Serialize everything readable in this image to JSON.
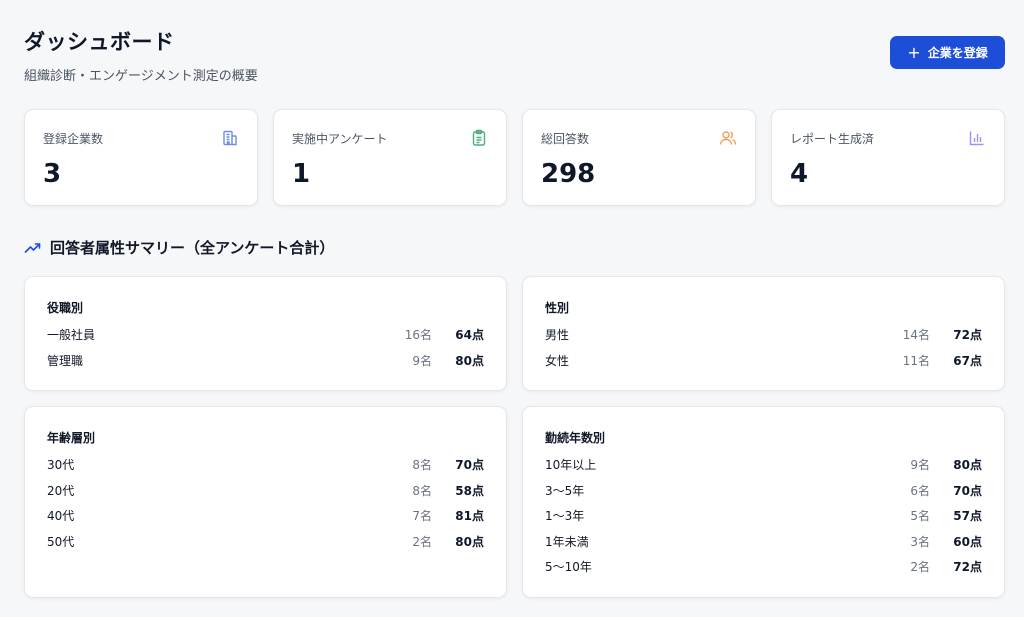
{
  "header": {
    "title": "ダッシュボード",
    "subtitle": "組織診断・エンゲージメント測定の概要",
    "register_button": "企業を登録",
    "register_icon": "plus-icon"
  },
  "stats": [
    {
      "label": "登録企業数",
      "value": "3",
      "icon": "building-icon",
      "color": "#6b8ce8"
    },
    {
      "label": "実施中アンケート",
      "value": "1",
      "icon": "clipboard-icon",
      "color": "#4caf7d"
    },
    {
      "label": "総回答数",
      "value": "298",
      "icon": "users-icon",
      "color": "#f59e5b"
    },
    {
      "label": "レポート生成済",
      "value": "4",
      "icon": "bar-chart-icon",
      "color": "#a78bfa"
    }
  ],
  "section": {
    "title": "回答者属性サマリー（全アンケート合計）",
    "icon": "trending-up-icon"
  },
  "panels": {
    "role": {
      "title": "役職別",
      "rows": [
        {
          "label": "一般社員",
          "count": "16名",
          "score": "64点"
        },
        {
          "label": "管理職",
          "count": "9名",
          "score": "80点"
        }
      ]
    },
    "gender": {
      "title": "性別",
      "rows": [
        {
          "label": "男性",
          "count": "14名",
          "score": "72点"
        },
        {
          "label": "女性",
          "count": "11名",
          "score": "67点"
        }
      ]
    },
    "age": {
      "title": "年齢層別",
      "rows": [
        {
          "label": "30代",
          "count": "8名",
          "score": "70点"
        },
        {
          "label": "20代",
          "count": "8名",
          "score": "58点"
        },
        {
          "label": "40代",
          "count": "7名",
          "score": "81点"
        },
        {
          "label": "50代",
          "count": "2名",
          "score": "80点"
        }
      ]
    },
    "tenure": {
      "title": "勤続年数別",
      "rows": [
        {
          "label": "10年以上",
          "count": "9名",
          "score": "80点"
        },
        {
          "label": "3〜5年",
          "count": "6名",
          "score": "70点"
        },
        {
          "label": "1〜3年",
          "count": "5名",
          "score": "57点"
        },
        {
          "label": "1年未満",
          "count": "3名",
          "score": "60点"
        },
        {
          "label": "5〜10年",
          "count": "2名",
          "score": "72点"
        }
      ]
    }
  }
}
